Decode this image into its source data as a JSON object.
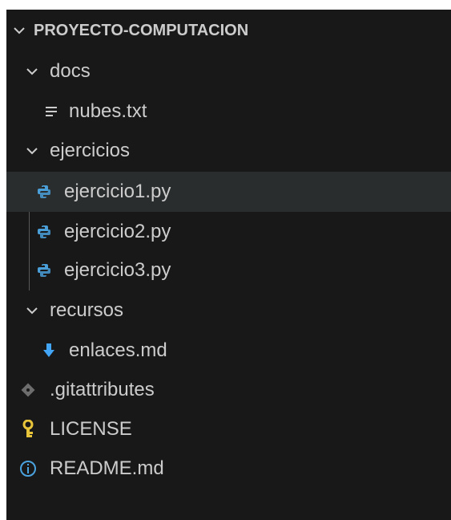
{
  "explorer": {
    "project_title": "PROYECTO-COMPUTACION",
    "items": [
      {
        "label": "docs",
        "icon": "chevron-down-icon"
      },
      {
        "label": "nubes.txt",
        "icon": "text-file-icon"
      },
      {
        "label": "ejercicios",
        "icon": "chevron-down-icon"
      },
      {
        "label": "ejercicio1.py",
        "icon": "python-icon",
        "selected": true
      },
      {
        "label": "ejercicio2.py",
        "icon": "python-icon"
      },
      {
        "label": "ejercicio3.py",
        "icon": "python-icon"
      },
      {
        "label": "recursos",
        "icon": "chevron-down-icon"
      },
      {
        "label": "enlaces.md",
        "icon": "markdown-download-icon"
      },
      {
        "label": ".gitattributes",
        "icon": "git-icon"
      },
      {
        "label": "LICENSE",
        "icon": "license-key-icon"
      },
      {
        "label": "README.md",
        "icon": "info-icon"
      }
    ]
  },
  "colors": {
    "background": "#181818",
    "text": "#cccccc",
    "selected_row": "#2a2d2e",
    "python_blue": "#4a9fd8",
    "markdown_blue": "#42a5f5",
    "git_grey": "#6d6d6d",
    "license_yellow": "#e8c43a",
    "info_blue": "#4aa3df"
  }
}
